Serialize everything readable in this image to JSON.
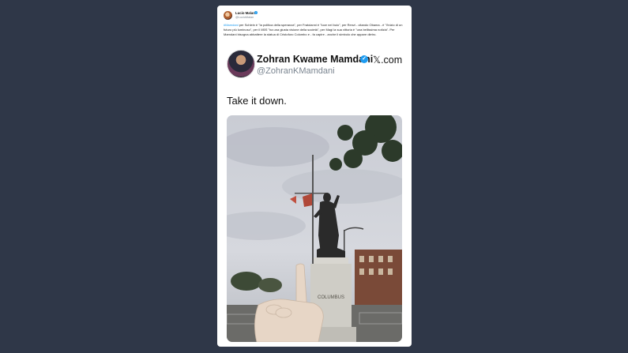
{
  "tweet": {
    "author_name": "Lucio Malan",
    "author_handle": "@LucioMalan",
    "text_hashtag": "#Mamdani",
    "text_body": " per Schlein è \"la politica della speranza\", per Fratoianni è \"luce nel buio\", per Renzi - citando Obama - è \"l'inizio di un futuro più luminoso\", per il M5S \"ha una giusta visione della società\", per Magi la sua vittoria è \"una bellissima notizia\". Per Mamdani bisogna abbattere la statua di Cristoforo Colombo e - fa capire - anche il simbolo che appare dietro."
  },
  "embed": {
    "name": "Zohran Kwame Mamdani",
    "handle": "@ZohranKMamdani",
    "source": "𝕏.com",
    "quote": "Take it down.",
    "photo_caption": "COLUMBUS"
  },
  "icons": {
    "verified": "verified-badge-icon",
    "x_logo": "x-logo-icon"
  },
  "colors": {
    "background": "#2f3748",
    "accent": "#1d9bf0"
  }
}
